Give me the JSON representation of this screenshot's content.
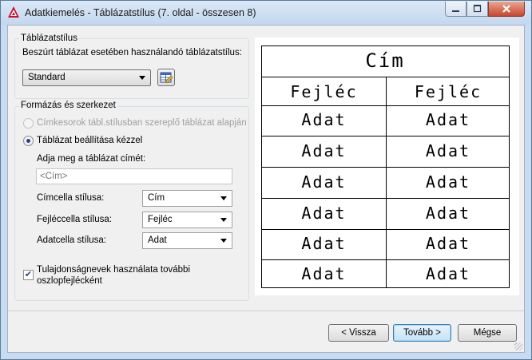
{
  "window": {
    "title": "Adatkiemelés - Táblázatstílus (7. oldal - összesen 8)"
  },
  "table_style_group": {
    "title": "Táblázatstílus",
    "description": "Beszúrt táblázat esetében használandó táblázatstílus:",
    "style_select": "Standard",
    "edit_icon": "table-style-edit-icon"
  },
  "format_group": {
    "title": "Formázás és szerkezet",
    "option_labels": "Címkesorok tábl.stílusban szereplő táblázat alapján",
    "option_manual": "Táblázat beállítása kézzel",
    "title_prompt": "Adja meg a táblázat címét:",
    "title_placeholder": "<Cím>",
    "title_cell_label": "Címcella stílusa:",
    "title_cell_value": "Cím",
    "header_cell_label": "Fejléccella stílusa:",
    "header_cell_value": "Fejléc",
    "data_cell_label": "Adatcella stílusa:",
    "data_cell_value": "Adat",
    "checkbox_line1": "Tulajdonságnevek használata további",
    "checkbox_line2": "oszlopfejlécként",
    "checkbox_checked": true
  },
  "preview": {
    "title": "Cím",
    "headers": [
      "Fejléc",
      "Fejléc"
    ],
    "data_rows": [
      [
        "Adat",
        "Adat"
      ],
      [
        "Adat",
        "Adat"
      ],
      [
        "Adat",
        "Adat"
      ],
      [
        "Adat",
        "Adat"
      ],
      [
        "Adat",
        "Adat"
      ],
      [
        "Adat",
        "Adat"
      ]
    ]
  },
  "buttons": {
    "back": "< Vissza",
    "next": "Tovább >",
    "cancel": "Mégse"
  }
}
